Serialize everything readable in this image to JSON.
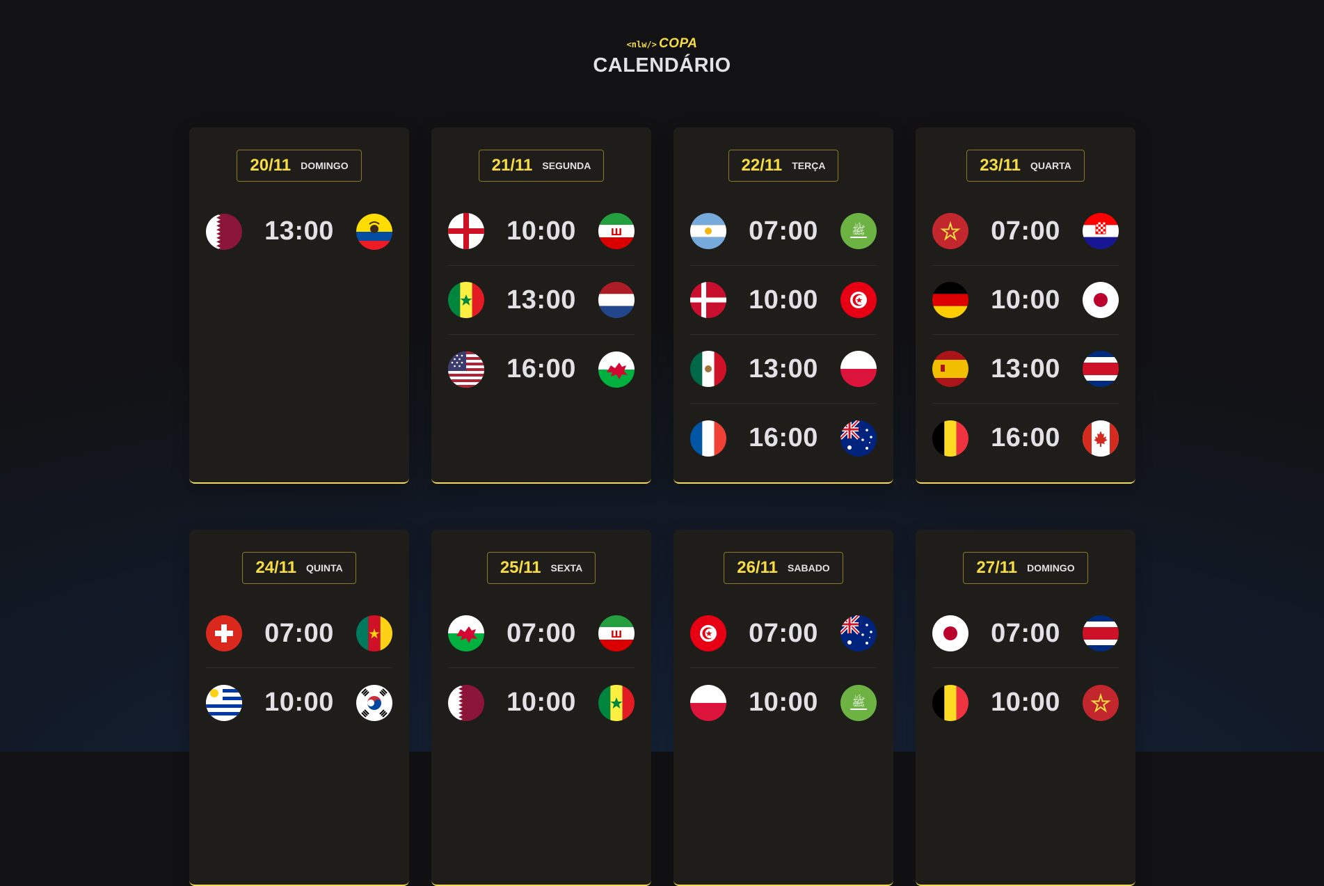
{
  "header": {
    "logo_tag": "<nlw/>",
    "logo_name": "COPA",
    "title": "CALENDÁRIO"
  },
  "days": [
    {
      "date": "20/11",
      "weekday": "DOMINGO",
      "matches": [
        {
          "home": "qatar",
          "time": "13:00",
          "away": "ecuador"
        }
      ]
    },
    {
      "date": "21/11",
      "weekday": "SEGUNDA",
      "matches": [
        {
          "home": "england",
          "time": "10:00",
          "away": "iran"
        },
        {
          "home": "senegal",
          "time": "13:00",
          "away": "netherlands"
        },
        {
          "home": "usa",
          "time": "16:00",
          "away": "wales"
        }
      ]
    },
    {
      "date": "22/11",
      "weekday": "TERÇA",
      "matches": [
        {
          "home": "argentina",
          "time": "07:00",
          "away": "saudi-arabia"
        },
        {
          "home": "denmark",
          "time": "10:00",
          "away": "tunisia"
        },
        {
          "home": "mexico",
          "time": "13:00",
          "away": "poland"
        },
        {
          "home": "france",
          "time": "16:00",
          "away": "australia"
        }
      ]
    },
    {
      "date": "23/11",
      "weekday": "QUARTA",
      "matches": [
        {
          "home": "morocco",
          "time": "07:00",
          "away": "croatia"
        },
        {
          "home": "germany",
          "time": "10:00",
          "away": "japan"
        },
        {
          "home": "spain",
          "time": "13:00",
          "away": "costa-rica"
        },
        {
          "home": "belgium",
          "time": "16:00",
          "away": "canada"
        }
      ]
    },
    {
      "date": "24/11",
      "weekday": "QUINTA",
      "matches": [
        {
          "home": "switzerland",
          "time": "07:00",
          "away": "cameroon"
        },
        {
          "home": "uruguay",
          "time": "10:00",
          "away": "south-korea"
        }
      ]
    },
    {
      "date": "25/11",
      "weekday": "SEXTA",
      "matches": [
        {
          "home": "wales",
          "time": "07:00",
          "away": "iran"
        },
        {
          "home": "qatar",
          "time": "10:00",
          "away": "senegal"
        }
      ]
    },
    {
      "date": "26/11",
      "weekday": "SABADO",
      "matches": [
        {
          "home": "tunisia",
          "time": "07:00",
          "away": "australia"
        },
        {
          "home": "poland",
          "time": "10:00",
          "away": "saudi-arabia"
        }
      ]
    },
    {
      "date": "27/11",
      "weekday": "DOMINGO",
      "matches": [
        {
          "home": "japan",
          "time": "07:00",
          "away": "costa-rica"
        },
        {
          "home": "belgium",
          "time": "10:00",
          "away": "morocco"
        }
      ]
    }
  ],
  "colors": {
    "accent": "#f7dd43",
    "card": "#1e1d1a",
    "text": "#e1e1e6"
  }
}
